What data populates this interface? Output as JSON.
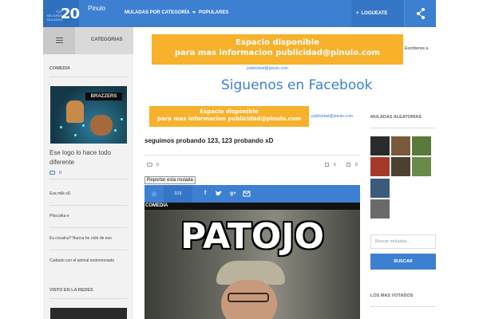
{
  "header": {
    "logo_small": "TOP MEJORES MULADAS",
    "logo_number": "20",
    "site_name": "Pinulo",
    "nav": [
      {
        "label": "MULADAS POR CATEGORÍA"
      },
      {
        "label": "POPULARES"
      }
    ],
    "login": "LOGUEATE CHINO!",
    "share_icon": "share-icon"
  },
  "sidebar": {
    "categories_label": "CATEGORIAS",
    "section_label": "COMEDIA",
    "featured_thumb_text": "BRAZZERS",
    "featured_title": "Ese logo lo hace todo diferente",
    "featured_comments": "0",
    "links": [
      "Esa milk xD",
      "Pika pika e",
      "Es cocaína? Nunca he oído de eso",
      "Cuidado con el animal endemoniado"
    ],
    "section2_label": "VISTO EN LA REDES"
  },
  "main": {
    "ad1_line1": "Espacio disponible",
    "ad1_line2": "para mas informacion publicidad@pinulo.com",
    "ad1_side": "Escríbenos a",
    "ad1_link": "publicidad@pinulo.com.",
    "follow": "Siguenos en Facebook",
    "ad2_line1": "Espacio disponible",
    "ad2_line2": "para mas informacion publicidad@pinulo.com",
    "ad2_link": "publicidad@pinulo.com.",
    "post_title": "seguimos probando 123, 123 probando xD",
    "comments": "0",
    "likes": "0",
    "dislikes": "0",
    "report": "Reportar esta mulada",
    "share_count": "315",
    "category": "COMEDIA",
    "meme_text": "PATOJO"
  },
  "right": {
    "random_label": "MULADAS ALEATORIAS",
    "search_placeholder": "Buscar mulados...",
    "search_button": "BUSCAR",
    "top_label": "LOS MAS VOTADOS"
  },
  "colors": {
    "accent": "#3d7fd1",
    "ad": "#f7b12b"
  }
}
